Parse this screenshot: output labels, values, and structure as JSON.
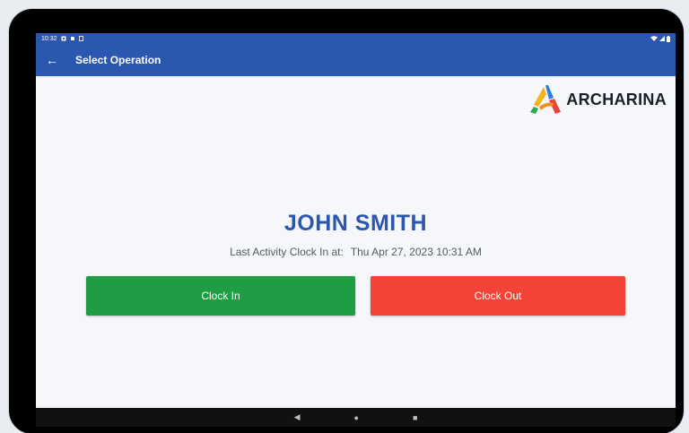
{
  "status_bar": {
    "time": "10:32",
    "icons": [
      "notification-icon",
      "sd-card-icon",
      "battery-saver-icon"
    ],
    "right_icons": [
      "wifi-icon",
      "signal-icon",
      "battery-icon"
    ]
  },
  "app_bar": {
    "back_icon": "←",
    "title": "Select Operation",
    "color": "#2b57b0"
  },
  "logo": {
    "text": "ARCHARINA"
  },
  "user": {
    "name": "JOHN SMITH",
    "last_activity_label": "Last Activity Clock In at:",
    "last_activity_time": "Thu Apr 27, 2023 10:31 AM"
  },
  "actions": {
    "clock_in_label": "Clock In",
    "clock_out_label": "Clock Out",
    "clock_in_color": "#1f9d43",
    "clock_out_color": "#f34337"
  },
  "nav": {
    "back": "◀",
    "home": "●",
    "recents": "■"
  }
}
